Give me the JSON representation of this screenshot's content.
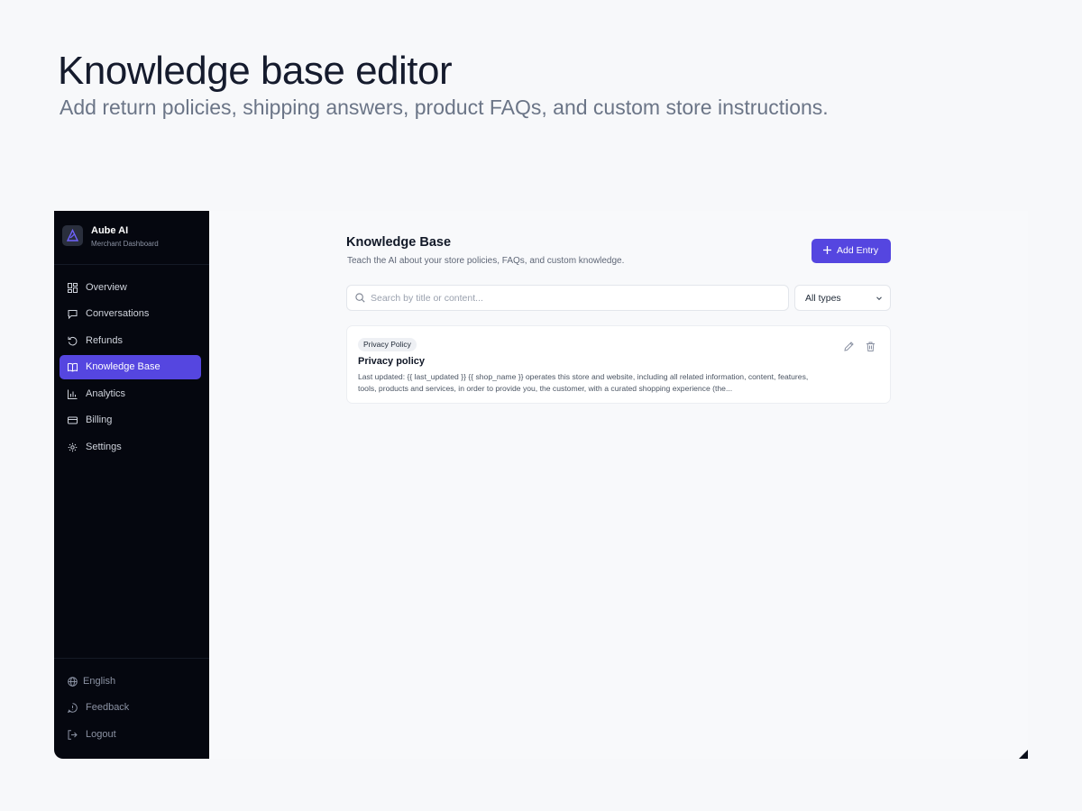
{
  "hero": {
    "title": "Knowledge base editor",
    "subtitle": "Add return policies, shipping answers, product FAQs, and custom store instructions."
  },
  "brand": {
    "name": "Aube AI",
    "subtitle": "Merchant Dashboard",
    "logo_icon": "brand-logo-icon"
  },
  "sidebar": {
    "items": [
      {
        "label": "Overview",
        "icon": "grid-icon"
      },
      {
        "label": "Conversations",
        "icon": "chat-bubble-icon"
      },
      {
        "label": "Refunds",
        "icon": "refund-icon"
      },
      {
        "label": "Knowledge Base",
        "icon": "book-icon",
        "active": true
      },
      {
        "label": "Analytics",
        "icon": "bar-chart-icon"
      },
      {
        "label": "Billing",
        "icon": "credit-card-icon"
      },
      {
        "label": "Settings",
        "icon": "gear-icon"
      }
    ],
    "footer": [
      {
        "label": "English",
        "icon": "globe-icon"
      },
      {
        "label": "Feedback",
        "icon": "feedback-icon"
      },
      {
        "label": "Logout",
        "icon": "logout-icon"
      }
    ]
  },
  "page": {
    "title": "Knowledge Base",
    "subtitle": "Teach the AI about your store policies, FAQs, and custom knowledge.",
    "add_button": "Add Entry",
    "search_placeholder": "Search by title or content...",
    "type_filter": "All types"
  },
  "entries": [
    {
      "badge": "Privacy Policy",
      "title": "Privacy policy",
      "excerpt": "Last updated: {{ last_updated }} {{ shop_name }} operates this store and website, including all related information, content, features, tools, products and services, in order to provide you, the customer, with a curated shopping experience (the..."
    }
  ],
  "colors": {
    "accent": "#5546e0",
    "sidebar_bg": "#05070f",
    "page_bg": "#f7f8fa"
  }
}
